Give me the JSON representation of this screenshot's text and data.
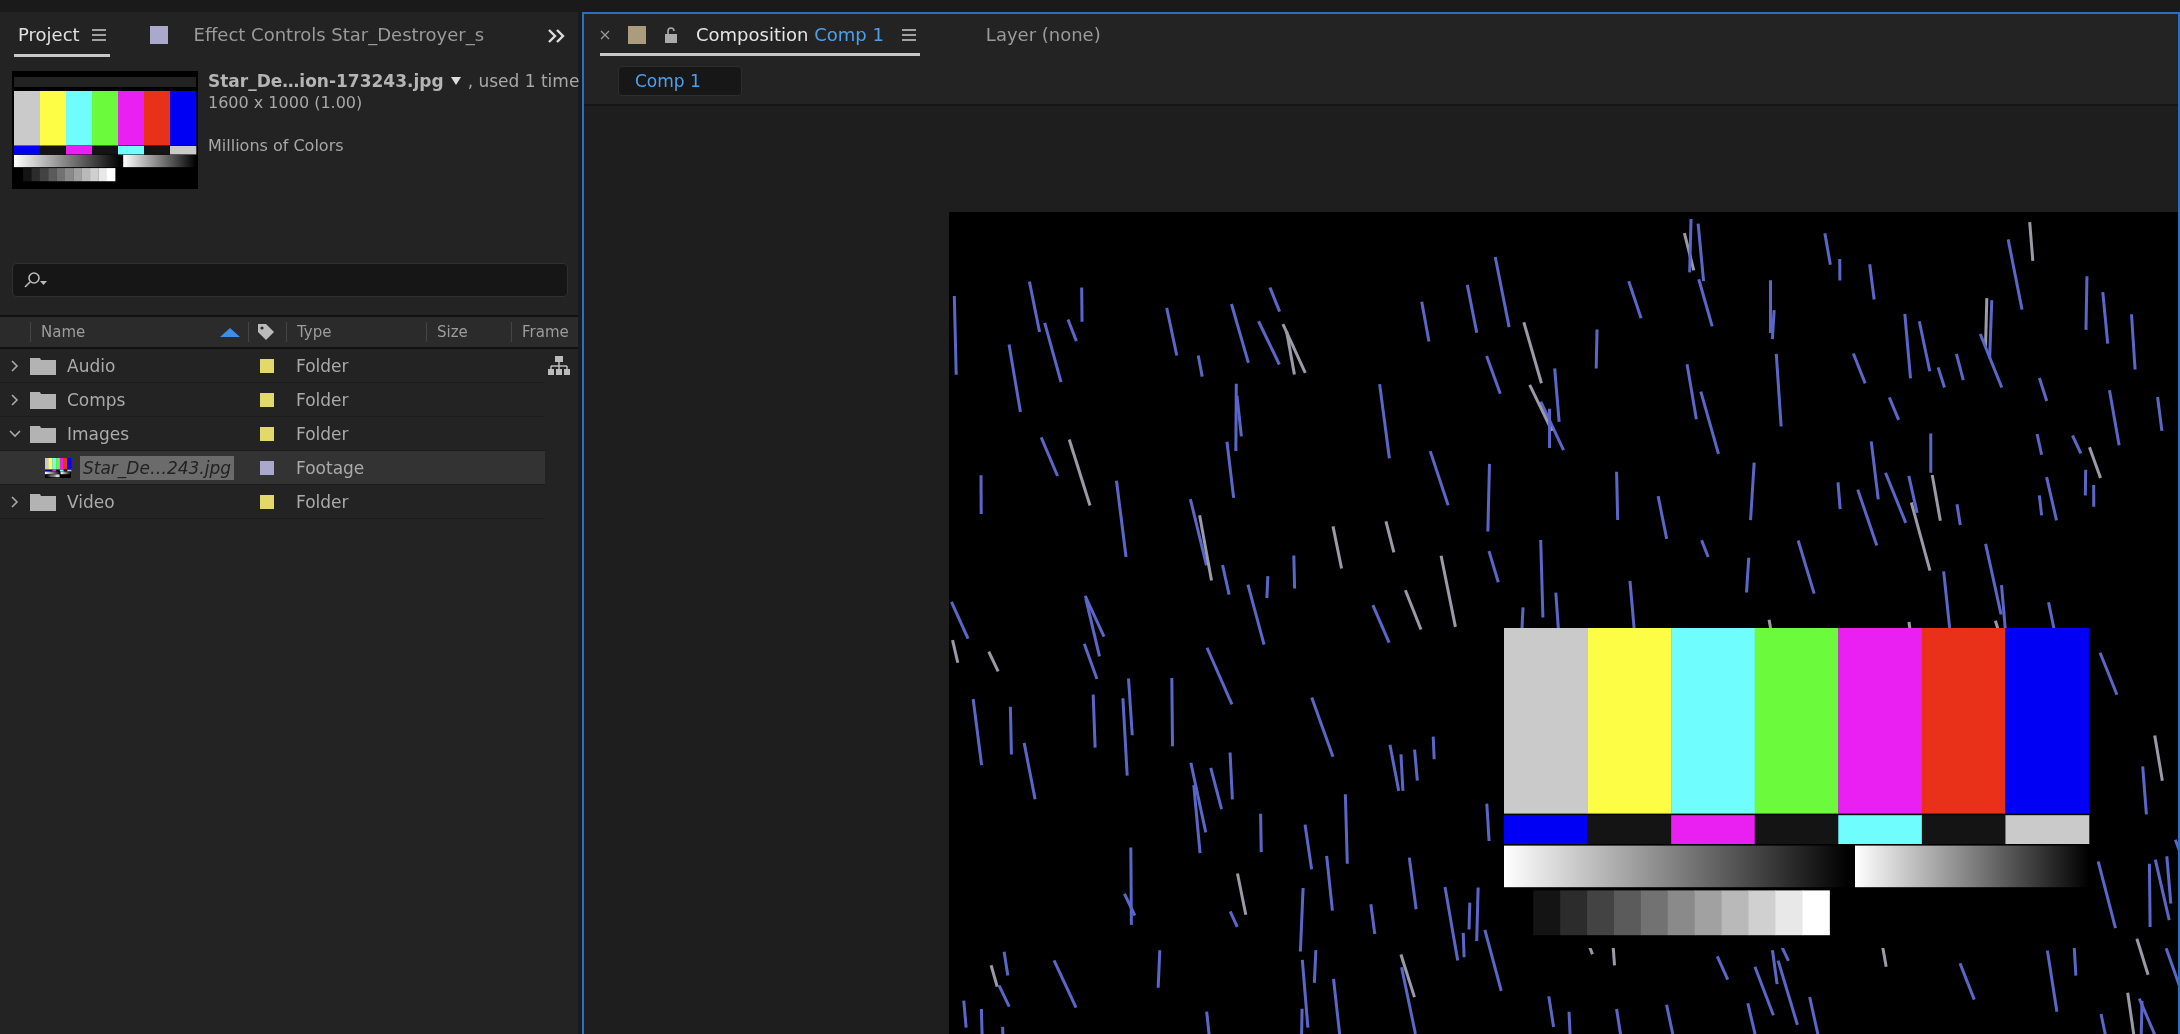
{
  "project_panel": {
    "tabs": [
      {
        "label": "Project",
        "selected": true
      },
      {
        "label": "Effect Controls Star_Destroyer_s",
        "selected": false
      }
    ],
    "preview": {
      "name": "Star_De…ion-173243.jpg",
      "usage": ", used 1 time",
      "dimensions": "1600 x 1000 (1.00)",
      "color_depth": "Millions of Colors"
    },
    "columns": [
      "Name",
      "Type",
      "Size",
      "Frame"
    ],
    "items": [
      {
        "name": "Audio",
        "kind": "folder",
        "type": "Folder",
        "color": "#e3d86a",
        "expanded": false,
        "selected": false
      },
      {
        "name": "Comps",
        "kind": "folder",
        "type": "Folder",
        "color": "#e3d86a",
        "expanded": false,
        "selected": false
      },
      {
        "name": "Images",
        "kind": "folder",
        "type": "Folder",
        "color": "#e3d86a",
        "expanded": true,
        "selected": false,
        "children": [
          {
            "name": "Star_De…243.jpg",
            "kind": "footage",
            "type": "Footage",
            "color": "#aaa8cc",
            "selected": true
          }
        ]
      },
      {
        "name": "Video",
        "kind": "folder",
        "type": "Folder",
        "color": "#e3d86a",
        "expanded": false,
        "selected": false
      }
    ]
  },
  "composition_panel": {
    "tabs": [
      {
        "label": "Composition",
        "comp": "Comp 1",
        "selected": true
      },
      {
        "label": "Layer (none)",
        "selected": false
      }
    ],
    "breadcrumb": "Comp 1"
  }
}
